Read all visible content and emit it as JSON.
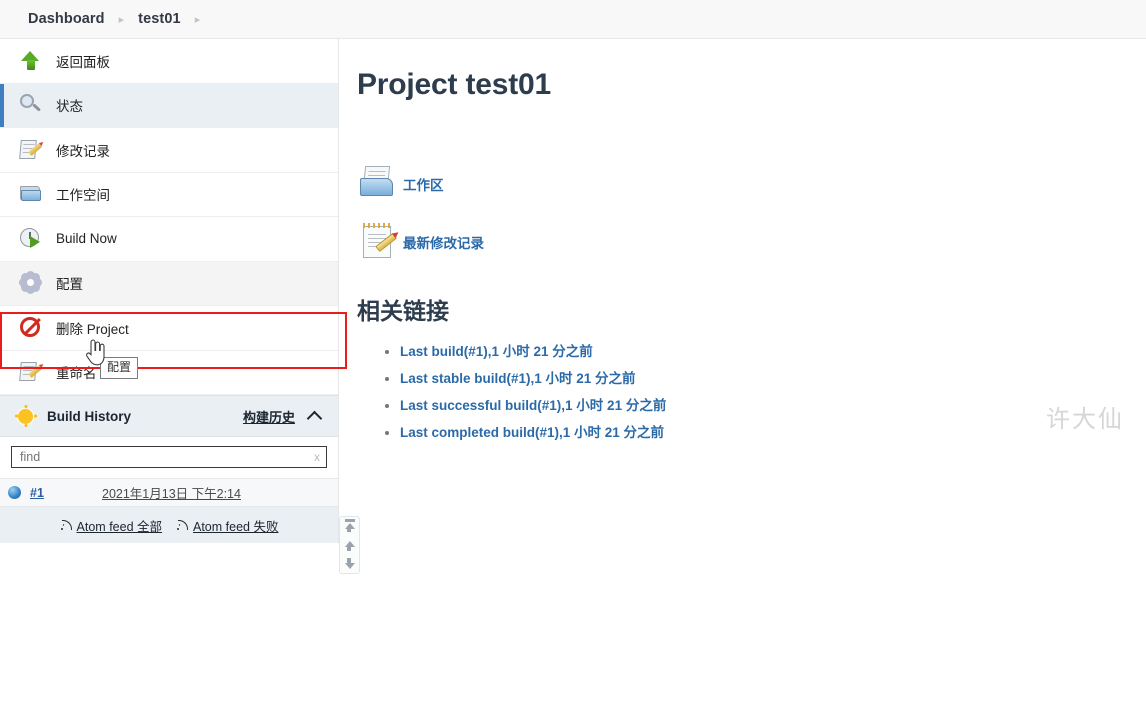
{
  "breadcrumb": {
    "items": [
      "Dashboard",
      "test01"
    ],
    "separator": "▸"
  },
  "sidebar": {
    "items": [
      {
        "label": "返回面板",
        "icon": "up-arrow-icon",
        "state": "normal"
      },
      {
        "label": "状态",
        "icon": "magnifier-icon",
        "state": "selected"
      },
      {
        "label": "修改记录",
        "icon": "notepad-pencil-icon",
        "state": "normal"
      },
      {
        "label": "工作空间",
        "icon": "folder-icon",
        "state": "normal"
      },
      {
        "label": "Build Now",
        "icon": "clock-play-icon",
        "state": "normal"
      },
      {
        "label": "配置",
        "icon": "gear-icon",
        "state": "hovered"
      },
      {
        "label": "删除 Project",
        "icon": "ban-icon",
        "state": "normal"
      },
      {
        "label": "重命名",
        "icon": "notepad-pencil-icon",
        "state": "normal"
      }
    ],
    "tooltip": "配置",
    "highlight_color": "#ea1c1c",
    "accent_color": "#3d7fc1"
  },
  "build_history": {
    "title": "Build History",
    "link_label": "构建历史",
    "collapse_icon": "chevron-up-icon",
    "find_placeholder": "find",
    "find_value": "",
    "find_clear": "x",
    "builds": [
      {
        "status": "blue-ball",
        "number": "#1",
        "date": "2021年1月13日 下午2:14"
      }
    ],
    "feeds": [
      {
        "label": "Atom feed 全部"
      },
      {
        "label": "Atom feed 失败"
      }
    ]
  },
  "scroll_arrows": [
    {
      "name": "scroll-to-top"
    },
    {
      "name": "scroll-up"
    },
    {
      "name": "scroll-down"
    }
  ],
  "main": {
    "title": "Project test01",
    "doc_links": [
      {
        "label": "工作区",
        "icon": "workspace-folder-icon"
      },
      {
        "label": "最新修改记录",
        "icon": "changes-notepad-icon"
      }
    ],
    "related_title": "相关链接",
    "related_links": [
      "Last build(#1),1 小时 21 分之前",
      "Last stable build(#1),1 小时 21 分之前",
      "Last successful build(#1),1 小时 21 分之前",
      "Last completed build(#1),1 小时 21 分之前"
    ]
  },
  "watermark": "许大仙"
}
